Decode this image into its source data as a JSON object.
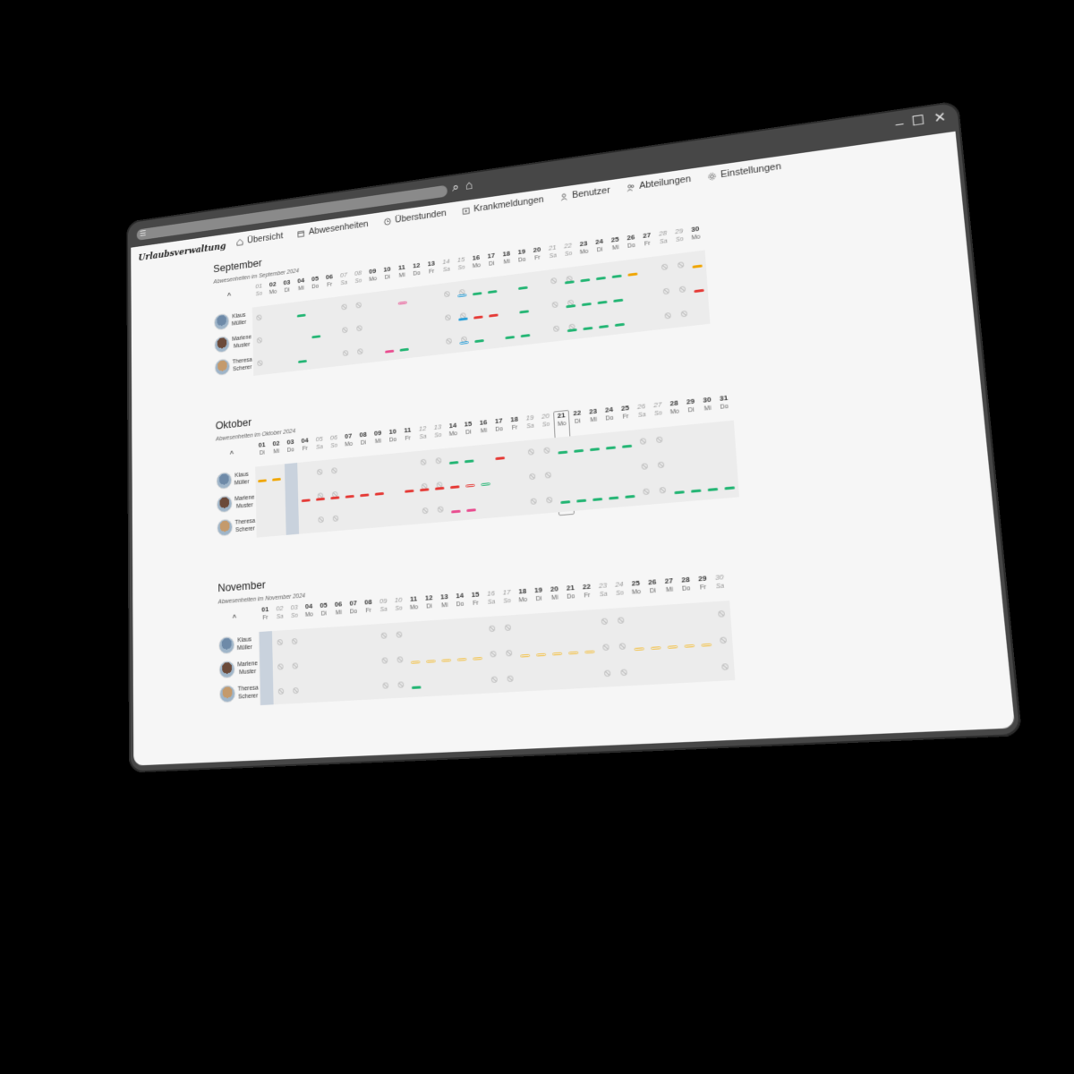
{
  "window": {
    "controls": [
      "minimize-icon",
      "maximize-icon",
      "close-icon"
    ]
  },
  "nav": {
    "brand": "Urlaubsverwaltung",
    "items": [
      {
        "label": "Übersicht",
        "icon": "home-icon"
      },
      {
        "label": "Abwesenheiten",
        "icon": "calendar-icon"
      },
      {
        "label": "Überstunden",
        "icon": "clock-icon"
      },
      {
        "label": "Krankmeldungen",
        "icon": "medical-icon"
      },
      {
        "label": "Benutzer",
        "icon": "user-icon"
      },
      {
        "label": "Abteilungen",
        "icon": "users-icon"
      },
      {
        "label": "Einstellungen",
        "icon": "gear-icon"
      }
    ]
  },
  "colors": {
    "green": "#22b573",
    "red": "#e53935",
    "orange": "#f0a500",
    "yellow": "#f3c24a",
    "pink": "#e94c8f",
    "blue": "#2a9fd8",
    "holiday": "#c9d2dd"
  },
  "users": [
    {
      "first": "Klaus",
      "last": "Müller"
    },
    {
      "first": "Marlene",
      "last": "Muster"
    },
    {
      "first": "Theresa",
      "last": "Scherer"
    }
  ],
  "months": [
    {
      "title": "September",
      "subtitle": "Abwesenheiten im September 2024",
      "collapse": "^",
      "days": [
        [
          "01",
          "So"
        ],
        [
          "02",
          "Mo"
        ],
        [
          "03",
          "Di"
        ],
        [
          "04",
          "Mi"
        ],
        [
          "05",
          "Do"
        ],
        [
          "06",
          "Fr"
        ],
        [
          "07",
          "Sa"
        ],
        [
          "08",
          "So"
        ],
        [
          "09",
          "Mo"
        ],
        [
          "10",
          "Di"
        ],
        [
          "11",
          "Mi"
        ],
        [
          "12",
          "Do"
        ],
        [
          "13",
          "Fr"
        ],
        [
          "14",
          "Sa"
        ],
        [
          "15",
          "So"
        ],
        [
          "16",
          "Mo"
        ],
        [
          "17",
          "Di"
        ],
        [
          "18",
          "Mi"
        ],
        [
          "19",
          "Do"
        ],
        [
          "20",
          "Fr"
        ],
        [
          "21",
          "Sa"
        ],
        [
          "22",
          "So"
        ],
        [
          "23",
          "Mo"
        ],
        [
          "24",
          "Di"
        ],
        [
          "25",
          "Mi"
        ],
        [
          "26",
          "Do"
        ],
        [
          "27",
          "Fr"
        ],
        [
          "28",
          "Sa"
        ],
        [
          "29",
          "So"
        ],
        [
          "30",
          "Mo"
        ]
      ],
      "holidays": [],
      "today": null,
      "absences": [
        [
          [
            4,
            "green"
          ],
          [
            11,
            "pink",
            "open"
          ],
          [
            15,
            "blue",
            "open"
          ],
          [
            16,
            "green"
          ],
          [
            17,
            "green"
          ],
          [
            19,
            "green"
          ],
          [
            22,
            "green"
          ],
          [
            23,
            "green"
          ],
          [
            24,
            "green"
          ],
          [
            25,
            "green"
          ],
          [
            26,
            "orange"
          ],
          [
            30,
            "orange"
          ]
        ],
        [
          [
            5,
            "green"
          ],
          [
            15,
            "blue"
          ],
          [
            16,
            "red"
          ],
          [
            17,
            "red"
          ],
          [
            19,
            "green"
          ],
          [
            22,
            "green"
          ],
          [
            23,
            "green"
          ],
          [
            24,
            "green"
          ],
          [
            25,
            "green"
          ],
          [
            30,
            "red"
          ]
        ],
        [
          [
            4,
            "green"
          ],
          [
            10,
            "pink"
          ],
          [
            11,
            "green"
          ],
          [
            15,
            "blue",
            "open"
          ],
          [
            16,
            "green"
          ],
          [
            18,
            "green"
          ],
          [
            19,
            "green"
          ],
          [
            22,
            "green"
          ],
          [
            23,
            "green"
          ],
          [
            24,
            "green"
          ],
          [
            25,
            "green"
          ]
        ]
      ]
    },
    {
      "title": "Oktober",
      "subtitle": "Abwesenheiten im Oktober 2024",
      "collapse": "^",
      "days": [
        [
          "01",
          "Di"
        ],
        [
          "02",
          "Mi"
        ],
        [
          "03",
          "Do"
        ],
        [
          "04",
          "Fr"
        ],
        [
          "05",
          "Sa"
        ],
        [
          "06",
          "So"
        ],
        [
          "07",
          "Mo"
        ],
        [
          "08",
          "Di"
        ],
        [
          "09",
          "Mi"
        ],
        [
          "10",
          "Do"
        ],
        [
          "11",
          "Fr"
        ],
        [
          "12",
          "Sa"
        ],
        [
          "13",
          "So"
        ],
        [
          "14",
          "Mo"
        ],
        [
          "15",
          "Di"
        ],
        [
          "16",
          "Mi"
        ],
        [
          "17",
          "Do"
        ],
        [
          "18",
          "Fr"
        ],
        [
          "19",
          "Sa"
        ],
        [
          "20",
          "So"
        ],
        [
          "21",
          "Mo"
        ],
        [
          "22",
          "Di"
        ],
        [
          "23",
          "Mi"
        ],
        [
          "24",
          "Do"
        ],
        [
          "25",
          "Fr"
        ],
        [
          "26",
          "Sa"
        ],
        [
          "27",
          "So"
        ],
        [
          "28",
          "Mo"
        ],
        [
          "29",
          "Di"
        ],
        [
          "30",
          "Mi"
        ],
        [
          "31",
          "Do"
        ]
      ],
      "holidays": [
        3
      ],
      "today": 21,
      "absences": [
        [
          [
            1,
            "orange"
          ],
          [
            2,
            "orange"
          ],
          [
            14,
            "green"
          ],
          [
            15,
            "green"
          ],
          [
            17,
            "red"
          ],
          [
            21,
            "green"
          ],
          [
            22,
            "green"
          ],
          [
            23,
            "green"
          ],
          [
            24,
            "green"
          ],
          [
            25,
            "green"
          ]
        ],
        [
          [
            4,
            "red"
          ],
          [
            5,
            "red"
          ],
          [
            6,
            "red"
          ],
          [
            7,
            "red"
          ],
          [
            8,
            "red"
          ],
          [
            9,
            "red"
          ],
          [
            11,
            "red"
          ],
          [
            12,
            "red"
          ],
          [
            13,
            "red"
          ],
          [
            14,
            "red"
          ],
          [
            15,
            "red",
            "open"
          ],
          [
            16,
            "green",
            "open"
          ]
        ],
        [
          [
            14,
            "pink"
          ],
          [
            15,
            "pink"
          ],
          [
            21,
            "green"
          ],
          [
            22,
            "green"
          ],
          [
            23,
            "green"
          ],
          [
            24,
            "green"
          ],
          [
            25,
            "green"
          ],
          [
            28,
            "green"
          ],
          [
            29,
            "green"
          ],
          [
            30,
            "green"
          ],
          [
            31,
            "green"
          ]
        ]
      ]
    },
    {
      "title": "November",
      "subtitle": "Abwesenheiten im November 2024",
      "collapse": "^",
      "days": [
        [
          "01",
          "Fr"
        ],
        [
          "02",
          "Sa"
        ],
        [
          "03",
          "So"
        ],
        [
          "04",
          "Mo"
        ],
        [
          "05",
          "Di"
        ],
        [
          "06",
          "Mi"
        ],
        [
          "07",
          "Do"
        ],
        [
          "08",
          "Fr"
        ],
        [
          "09",
          "Sa"
        ],
        [
          "10",
          "So"
        ],
        [
          "11",
          "Mo"
        ],
        [
          "12",
          "Di"
        ],
        [
          "13",
          "Mi"
        ],
        [
          "14",
          "Do"
        ],
        [
          "15",
          "Fr"
        ],
        [
          "16",
          "Sa"
        ],
        [
          "17",
          "So"
        ],
        [
          "18",
          "Mo"
        ],
        [
          "19",
          "Di"
        ],
        [
          "20",
          "Mi"
        ],
        [
          "21",
          "Do"
        ],
        [
          "22",
          "Fr"
        ],
        [
          "23",
          "Sa"
        ],
        [
          "24",
          "So"
        ],
        [
          "25",
          "Mo"
        ],
        [
          "26",
          "Di"
        ],
        [
          "27",
          "Mi"
        ],
        [
          "28",
          "Do"
        ],
        [
          "29",
          "Fr"
        ],
        [
          "30",
          "Sa"
        ]
      ],
      "holidays": [
        1
      ],
      "today": null,
      "absences": [
        [],
        [
          [
            11,
            "yellow",
            "open"
          ],
          [
            12,
            "yellow",
            "open"
          ],
          [
            13,
            "yellow",
            "open"
          ],
          [
            14,
            "yellow",
            "open"
          ],
          [
            15,
            "yellow",
            "open"
          ],
          [
            18,
            "yellow",
            "open"
          ],
          [
            19,
            "yellow",
            "open"
          ],
          [
            20,
            "yellow",
            "open"
          ],
          [
            21,
            "yellow",
            "open"
          ],
          [
            22,
            "yellow",
            "open"
          ],
          [
            25,
            "yellow",
            "open"
          ],
          [
            26,
            "yellow",
            "open"
          ],
          [
            27,
            "yellow",
            "open"
          ],
          [
            28,
            "yellow",
            "open"
          ],
          [
            29,
            "yellow",
            "open"
          ]
        ],
        [
          [
            11,
            "green"
          ]
        ]
      ]
    }
  ]
}
